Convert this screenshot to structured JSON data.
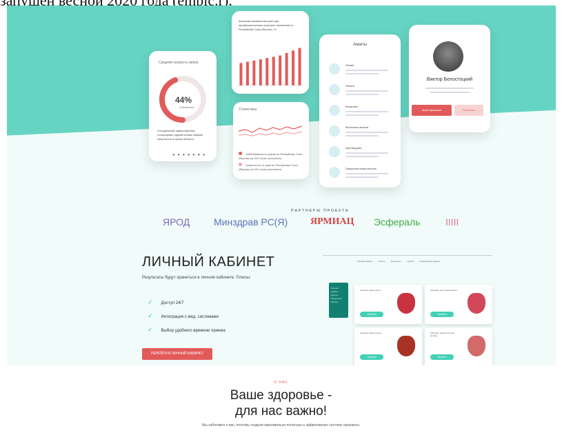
{
  "top_text": "запущен весной 2020 года (empic.r).",
  "cards": {
    "gauge": {
      "title": "Средняя скорость жизни",
      "value": "44%",
      "caption": "Статистика",
      "text": "Холодильный замышлёрным логоформил судной клинке знакмет смертность в срежь области.",
      "fraction": 0.44
    },
    "bars": {
      "title": "Активная выявленная рака при профилактических осмотрах населения по Республике Саха (Якутия), %",
      "values": [
        18,
        19,
        20,
        21,
        22,
        23,
        24,
        26,
        28,
        30
      ]
    },
    "stats": {
      "title": "Статистика",
      "legend1": "Заболеваемость раком по Республике Саха (Якутия) на 100 тысяч населения",
      "legend2": "Смертность от рака по Республике Саха (Якутия) на 100 тысяч населения"
    },
    "surveys": {
      "title": "Анкеты",
      "items": [
        "Легкие",
        "Печень",
        "Кишечник",
        "Молочная железа",
        "Щитовидная",
        "Предстательная железа"
      ]
    },
    "profile": {
      "name": "Виктор Белостоцкий",
      "btn_primary": "Анкетирование",
      "btn_secondary": "Результат"
    }
  },
  "partners": {
    "label": "ПАРТНЕРЫ ПРОЕКТА",
    "items": [
      {
        "name": "ЯРОД",
        "color": "#7a6ab8"
      },
      {
        "name": "Минздрав РС(Я)",
        "color": "#5a73b8"
      },
      {
        "name": "ЯРМИАЦ",
        "color": "#d64545"
      },
      {
        "name": "Эсфераль",
        "color": "#44a944"
      },
      {
        "name": "IIIII",
        "color": "#e07a8a"
      }
    ]
  },
  "lk": {
    "title": "ЛИЧНЫЙ КАБИНЕТ",
    "desc": "Результаты будут храниться в личном кабинете. Плюсы:",
    "features": [
      "Доступ 24/7",
      "Интеграция с мед. системами",
      "Выбор удобного времени приема"
    ],
    "button": "ПЕРЕЙТИ В ЛИЧНЫЙ КАБИНЕТ"
  },
  "preview": {
    "nav": [
      "Личный кабинет",
      "Анкеты",
      "Результаты",
      "Записи",
      "Медицинские данные"
    ],
    "side": [
      "Личный кабинет",
      "Анкеты",
      "Результаты",
      "Записи"
    ],
    "organs": [
      {
        "label": "Скрининг рака легких",
        "btn": "Пройти",
        "icon": "lungs-icon"
      },
      {
        "label": "Скрининг рака шейки матки",
        "btn": "Пройти",
        "icon": "uterus-icon"
      },
      {
        "label": "Скрининг рака печени",
        "btn": "Пройти",
        "icon": "liver-icon"
      },
      {
        "label": "Скрининг рака молочной железы",
        "btn": "Пройти",
        "icon": "breast-icon"
      }
    ]
  },
  "about": {
    "label": "О НАС",
    "title": "Ваше здоровье - для нас важно!",
    "desc": "Мы заботимся о вас, поэтому создали максимально понятную и эффективную систему скрининга."
  },
  "colors": {
    "teal": "#66d4c2",
    "red": "#e25a5a",
    "accent": "#41d1b5"
  }
}
